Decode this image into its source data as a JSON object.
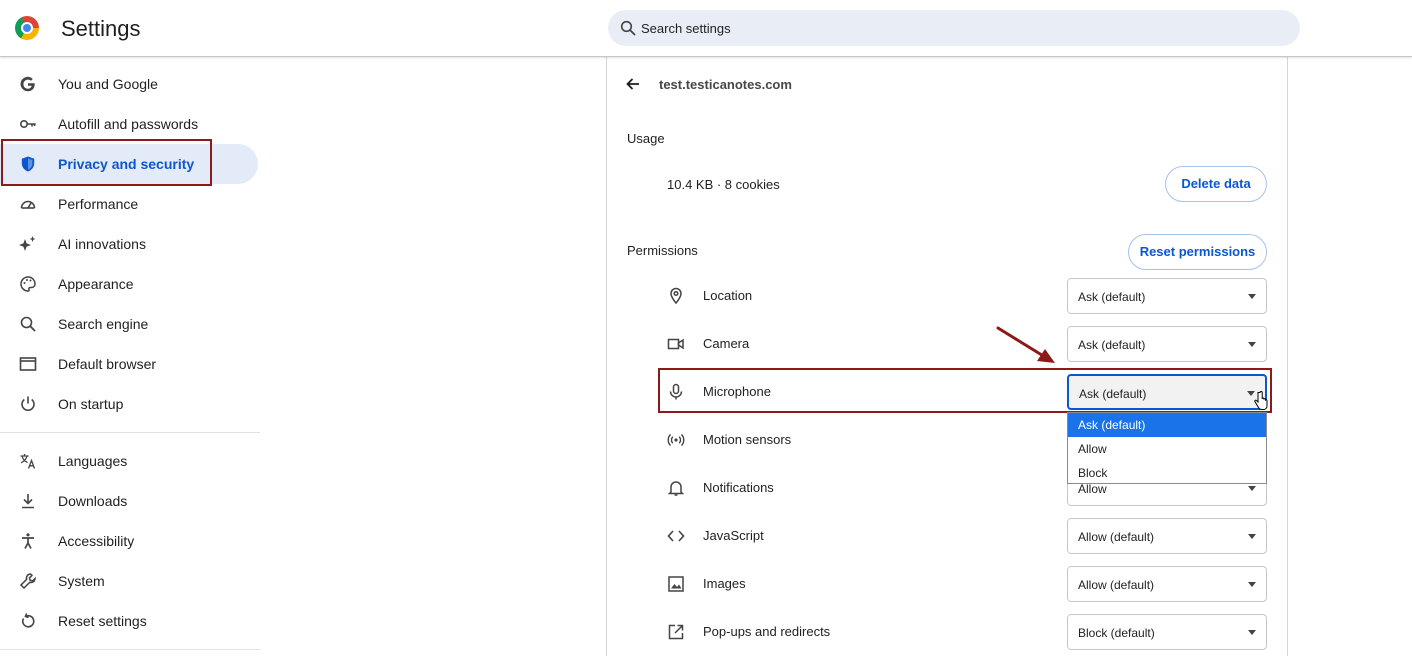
{
  "header": {
    "app_title": "Settings",
    "search_placeholder": "Search settings"
  },
  "sidebar": {
    "items": [
      {
        "label": "You and Google",
        "icon": "google-icon"
      },
      {
        "label": "Autofill and passwords",
        "icon": "key-icon"
      },
      {
        "label": "Privacy and security",
        "icon": "shield-icon",
        "active": true
      },
      {
        "label": "Performance",
        "icon": "speedometer-icon"
      },
      {
        "label": "AI innovations",
        "icon": "sparkle-icon"
      },
      {
        "label": "Appearance",
        "icon": "palette-icon"
      },
      {
        "label": "Search engine",
        "icon": "search-icon"
      },
      {
        "label": "Default browser",
        "icon": "browser-window-icon"
      },
      {
        "label": "On startup",
        "icon": "power-icon"
      },
      {
        "label": "Languages",
        "icon": "translate-icon"
      },
      {
        "label": "Downloads",
        "icon": "download-icon"
      },
      {
        "label": "Accessibility",
        "icon": "accessibility-icon"
      },
      {
        "label": "System",
        "icon": "wrench-icon"
      },
      {
        "label": "Reset settings",
        "icon": "reset-icon"
      }
    ]
  },
  "site": {
    "name": "test.testicanotes.com"
  },
  "usage": {
    "heading": "Usage",
    "text": "10.4 KB · 8 cookies",
    "delete_button": "Delete data"
  },
  "permissions": {
    "heading": "Permissions",
    "reset_button": "Reset permissions",
    "rows": [
      {
        "label": "Location",
        "value": "Ask (default)",
        "icon": "location-pin-icon"
      },
      {
        "label": "Camera",
        "value": "Ask (default)",
        "icon": "camera-icon"
      },
      {
        "label": "Microphone",
        "value": "Ask (default)",
        "icon": "microphone-icon"
      },
      {
        "label": "Motion sensors",
        "value": "",
        "icon": "motion-sensor-icon"
      },
      {
        "label": "Notifications",
        "value": "Allow",
        "icon": "bell-icon"
      },
      {
        "label": "JavaScript",
        "value": "Allow (default)",
        "icon": "code-icon"
      },
      {
        "label": "Images",
        "value": "Allow (default)",
        "icon": "image-icon"
      },
      {
        "label": "Pop-ups and redirects",
        "value": "Block (default)",
        "icon": "external-link-icon"
      }
    ]
  },
  "dropdown": {
    "options": [
      "Ask (default)",
      "Allow",
      "Block"
    ],
    "selected": "Ask (default)"
  },
  "colors": {
    "accent": "#0b57d0",
    "highlight_border": "#8b1a1a",
    "dropdown_selected": "#1a73e8"
  }
}
